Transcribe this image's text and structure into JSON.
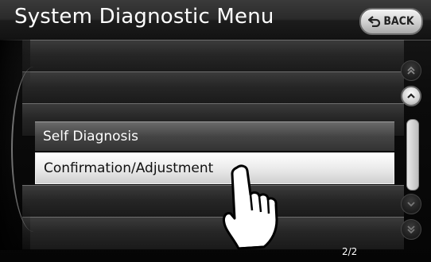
{
  "header": {
    "title": "System Diagnostic Menu",
    "back_label": "BACK"
  },
  "menu": {
    "items": [
      {
        "label": "Self Diagnosis",
        "selected": false
      },
      {
        "label": "Confirmation/Adjustment",
        "selected": true
      }
    ]
  },
  "pager": {
    "page_indicator": "2/2"
  },
  "icons": {
    "back": "back-arrow-icon",
    "page_up": "double-chevron-up-icon",
    "line_up": "chevron-up-icon",
    "line_down": "chevron-down-icon",
    "page_down": "double-chevron-down-icon",
    "cursor": "pointing-hand-icon"
  },
  "colors": {
    "selected_bg": "#f2f2f2",
    "list_bg": "#2a2a2a",
    "header_bg": "#2a2a2a"
  }
}
